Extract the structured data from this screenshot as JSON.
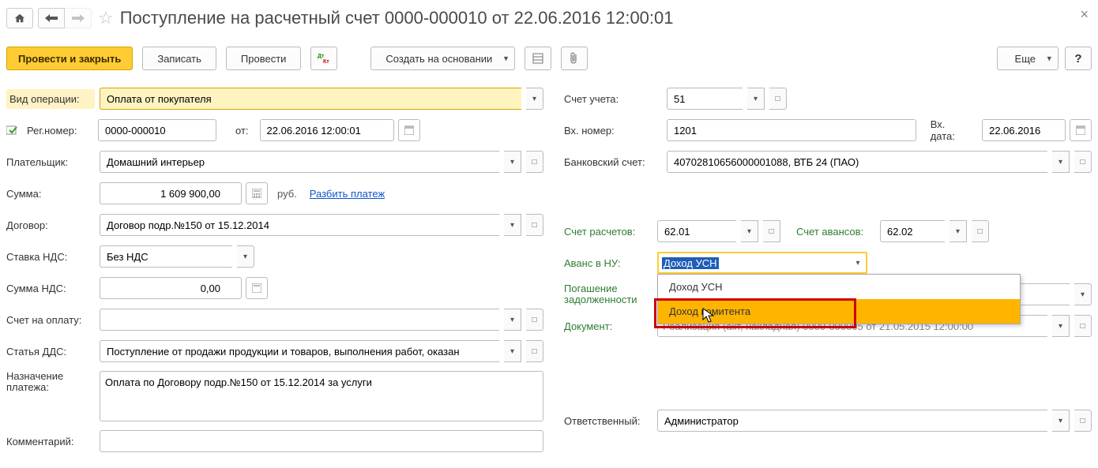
{
  "title": "Поступление на расчетный счет 0000-000010 от 22.06.2016 12:00:01",
  "toolbar": {
    "post_close": "Провести и закрыть",
    "save": "Записать",
    "post": "Провести",
    "create_based": "Создать на основании",
    "more": "Еще",
    "help": "?"
  },
  "left": {
    "op_type_label": "Вид операции:",
    "op_type": "Оплата от покупателя",
    "regnum_label": "Рег.номер:",
    "regnum": "0000-000010",
    "date_from_label": "от:",
    "date_from": "22.06.2016 12:00:01",
    "payer_label": "Плательщик:",
    "payer": "Домашний интерьер",
    "sum_label": "Сумма:",
    "sum": "1 609 900,00",
    "sum_unit": "руб.",
    "split_link": "Разбить платеж",
    "contract_label": "Договор:",
    "contract": "Договор подр.№150 от 15.12.2014",
    "vatrate_label": "Ставка НДС:",
    "vatrate": "Без НДС",
    "vatsum_label": "Сумма НДС:",
    "vatsum": "0,00",
    "invoice_label": "Счет на оплату:",
    "invoice": "",
    "dds_label": "Статья ДДС:",
    "dds": "Поступление от продажи продукции и товаров, выполнения работ, оказан",
    "purpose_label": "Назначение платежа:",
    "purpose": "Оплата по Договору подр.№150 от 15.12.2014 за услуги",
    "comment_label": "Комментарий:",
    "comment": ""
  },
  "right": {
    "account_label": "Счет учета:",
    "account": "51",
    "innum_label": "Вх. номер:",
    "innum": "1201",
    "indate_label": "Вх. дата:",
    "indate": "22.06.2016",
    "bank_label": "Банковский счет:",
    "bank": "40702810656000001088, ВТБ 24 (ПАО)",
    "settle_label": "Счет расчетов:",
    "settle": "62.01",
    "advance_acc_label": "Счет авансов:",
    "advance_acc": "62.02",
    "avans_label": "Аванс в НУ:",
    "avans_value": "Доход УСН",
    "avans_options": [
      "Доход УСН",
      "Доход комитента"
    ],
    "debt_label": "Погашение задолженности",
    "debt_value": "",
    "doc_label": "Документ:",
    "doc_value": "Реализация (акт, накладная) 0000-000005 от 21.05.2015 12:00:00",
    "resp_label": "Ответственный:",
    "resp": "Администратор"
  }
}
